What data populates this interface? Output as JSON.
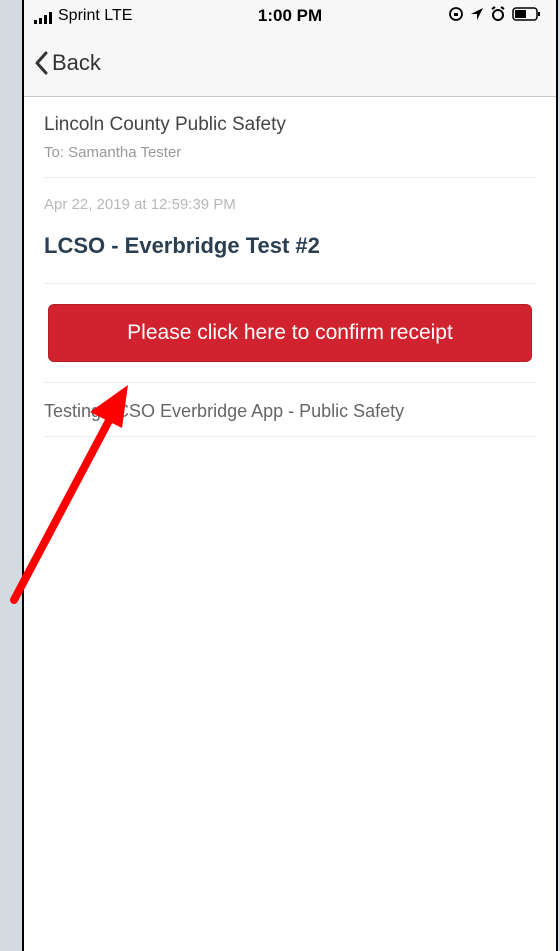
{
  "status_bar": {
    "carrier": "Sprint  LTE",
    "time": "1:00 PM",
    "icons": [
      "signal-bars-icon",
      "lock-rotation-icon",
      "location-arrow-icon",
      "alarm-icon",
      "battery-icon"
    ]
  },
  "nav": {
    "back_label": "Back"
  },
  "message": {
    "sender": "Lincoln County Public Safety",
    "to": "To: Samantha Tester",
    "date": "Apr 22, 2019 at 12:59:39 PM",
    "subject": "LCSO - Everbridge Test #2",
    "confirm_label": "Please click here to confirm receipt",
    "body": "Testing LCSO Everbridge App - Public Safety"
  },
  "colors": {
    "accent": "#d0222f",
    "subject": "#2a3f52",
    "annotation_arrow": "#ff0000",
    "page_bg": "#d3dbe0"
  }
}
